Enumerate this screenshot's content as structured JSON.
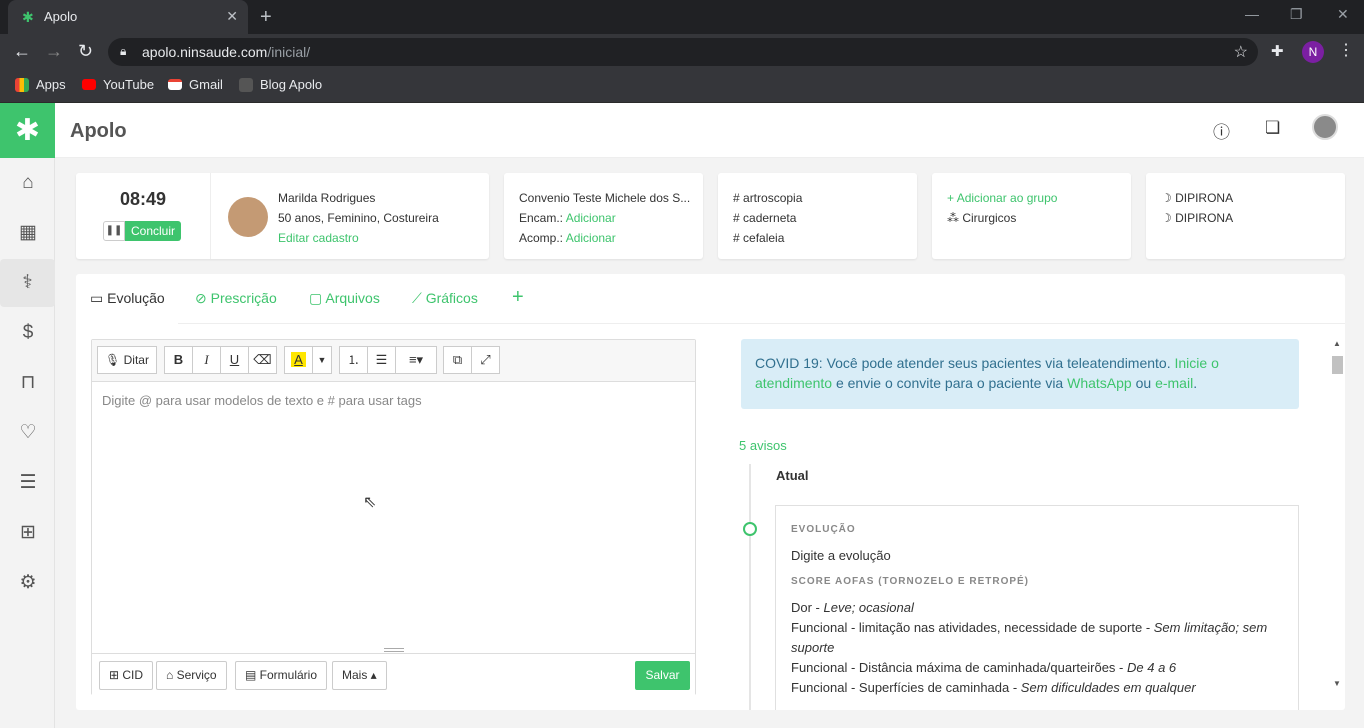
{
  "browser": {
    "tab_title": "Apolo",
    "url_host": "apolo.ninsaude.com",
    "url_path": "/inicial/",
    "profile_initial": "N",
    "bookmarks": [
      "Apps",
      "YouTube",
      "Gmail",
      "Blog Apolo"
    ]
  },
  "app": {
    "brand": "Apolo",
    "sidebar_icons": [
      "home-icon",
      "calendar-icon",
      "stethoscope-icon",
      "dollar-icon",
      "bag-icon",
      "heart-pulse-icon",
      "list-icon",
      "dashboard-icon",
      "gear-icon"
    ]
  },
  "timer": {
    "time": "08:49",
    "conclude": "Concluir"
  },
  "patient": {
    "name": "Marilda Rodrigues",
    "details": "50 anos, Feminino, Costureira",
    "edit": "Editar cadastro"
  },
  "insurance": {
    "name": "Convenio Teste Michele dos S...",
    "encam_label": "Encam.:",
    "encam_action": "Adicionar",
    "acomp_label": "Acomp.:",
    "acomp_action": "Adicionar"
  },
  "tags": [
    "artroscopia",
    "caderneta",
    "cefaleia"
  ],
  "groups": {
    "add": "Adicionar ao grupo",
    "item": "Cirurgicos"
  },
  "allergies": [
    "DIPIRONA",
    "DIPIRONA"
  ],
  "tabs": [
    "Evolução",
    "Prescrição",
    "Arquivos",
    "Gráficos"
  ],
  "editor": {
    "dictate": "Ditar",
    "placeholder": "Digite @ para usar modelos de texto e # para usar tags",
    "footer": {
      "cid": "CID",
      "service": "Serviço",
      "form": "Formulário",
      "more": "Mais",
      "save": "Salvar"
    }
  },
  "covid": {
    "text1": "COVID 19: Você pode atender seus pacientes via teleatendimento.",
    "link1": "Inicie o atendimento",
    "text2": "e envie o convite para o paciente via",
    "link2": "WhatsApp",
    "text3": "ou",
    "link3": "e-mail",
    "text4": "."
  },
  "timeline": {
    "avisos": "5 avisos",
    "current": "Atual",
    "evo_heading": "EVOLUÇÃO",
    "evo_text": "Digite a evolução",
    "score_heading": "SCORE AOFAS (TORNOZELO E RETROPÉ)",
    "items": [
      {
        "label": "Dor - ",
        "value": "Leve; ocasional"
      },
      {
        "label": "Funcional - limitação nas atividades, necessidade de suporte - ",
        "value": "Sem limitação; sem suporte"
      },
      {
        "label": "Funcional - Distância máxima de caminhada/quarteirões - ",
        "value": "De 4 a 6"
      },
      {
        "label": "Funcional - Superfícies de caminhada - ",
        "value": "Sem dificuldades em qualquer"
      }
    ]
  }
}
